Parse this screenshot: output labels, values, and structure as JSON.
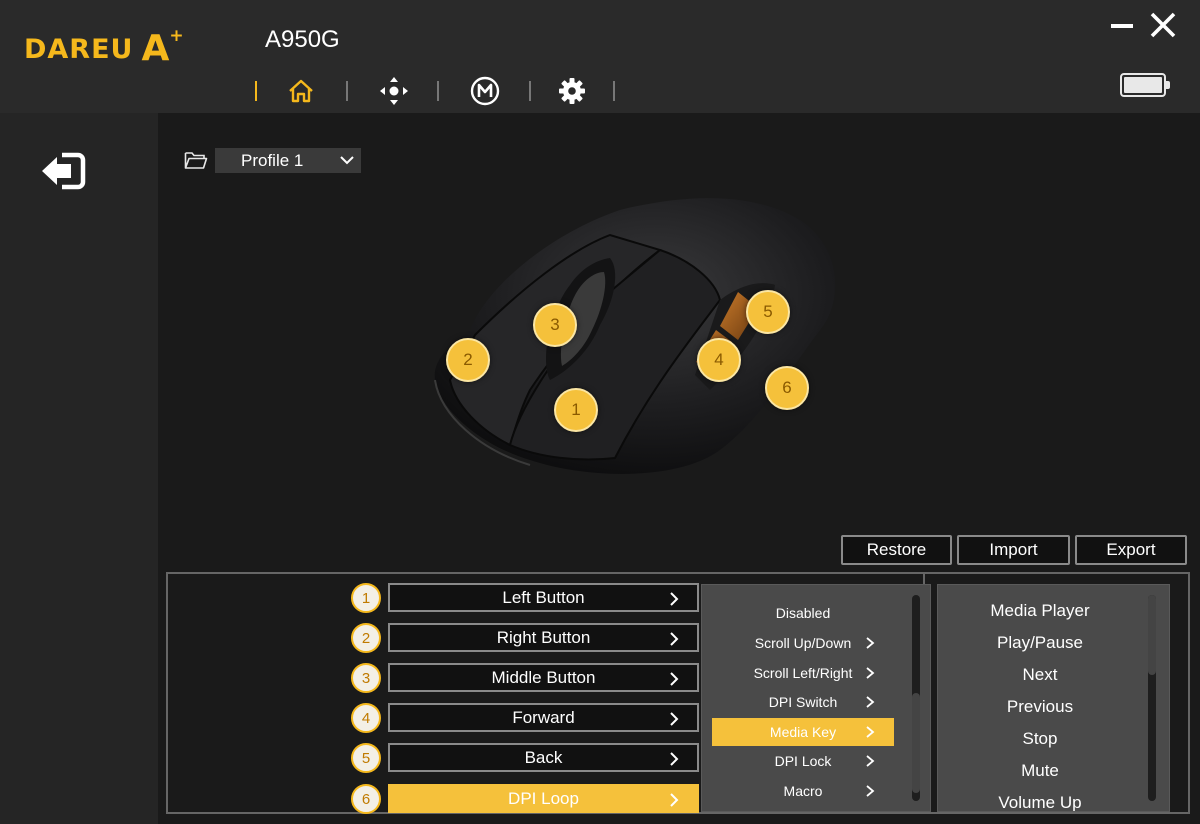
{
  "app": {
    "brand": "DAREU",
    "brand_mark": "A",
    "brand_plus": "+",
    "device": "A950G"
  },
  "nav": {
    "items": [
      {
        "name": "home",
        "icon": "home-icon",
        "active": true
      },
      {
        "name": "dpi",
        "icon": "dpi-crosshair-icon",
        "active": false
      },
      {
        "name": "macro",
        "icon": "macro-m-icon",
        "active": false
      },
      {
        "name": "settings",
        "icon": "gear-icon",
        "active": false
      }
    ]
  },
  "battery": {
    "level": 1.0
  },
  "profile": {
    "selected": "Profile 1"
  },
  "actions": {
    "restore": "Restore",
    "import": "Import",
    "export": "Export"
  },
  "hotspots": [
    "1",
    "2",
    "3",
    "4",
    "5",
    "6"
  ],
  "buttons": [
    {
      "num": "1",
      "label": "Left Button",
      "selected": false
    },
    {
      "num": "2",
      "label": "Right Button",
      "selected": false
    },
    {
      "num": "3",
      "label": "Middle Button",
      "selected": false
    },
    {
      "num": "4",
      "label": "Forward",
      "selected": false
    },
    {
      "num": "5",
      "label": "Back",
      "selected": false
    },
    {
      "num": "6",
      "label": "DPI Loop",
      "selected": true
    }
  ],
  "function_menu": [
    {
      "label": "Disabled",
      "submenu": false,
      "active": false
    },
    {
      "label": "Scroll Up/Down",
      "submenu": true,
      "active": false
    },
    {
      "label": "Scroll Left/Right",
      "submenu": true,
      "active": false
    },
    {
      "label": "DPI Switch",
      "submenu": true,
      "active": false
    },
    {
      "label": "Media Key",
      "submenu": true,
      "active": true
    },
    {
      "label": "DPI Lock",
      "submenu": true,
      "active": false
    },
    {
      "label": "Macro",
      "submenu": true,
      "active": false
    }
  ],
  "media_menu": [
    "Media Player",
    "Play/Pause",
    "Next",
    "Previous",
    "Stop",
    "Mute",
    "Volume Up"
  ],
  "colors": {
    "accent": "#f5c13b",
    "brand": "#f5b81c",
    "bg": "#1a1a1a"
  }
}
